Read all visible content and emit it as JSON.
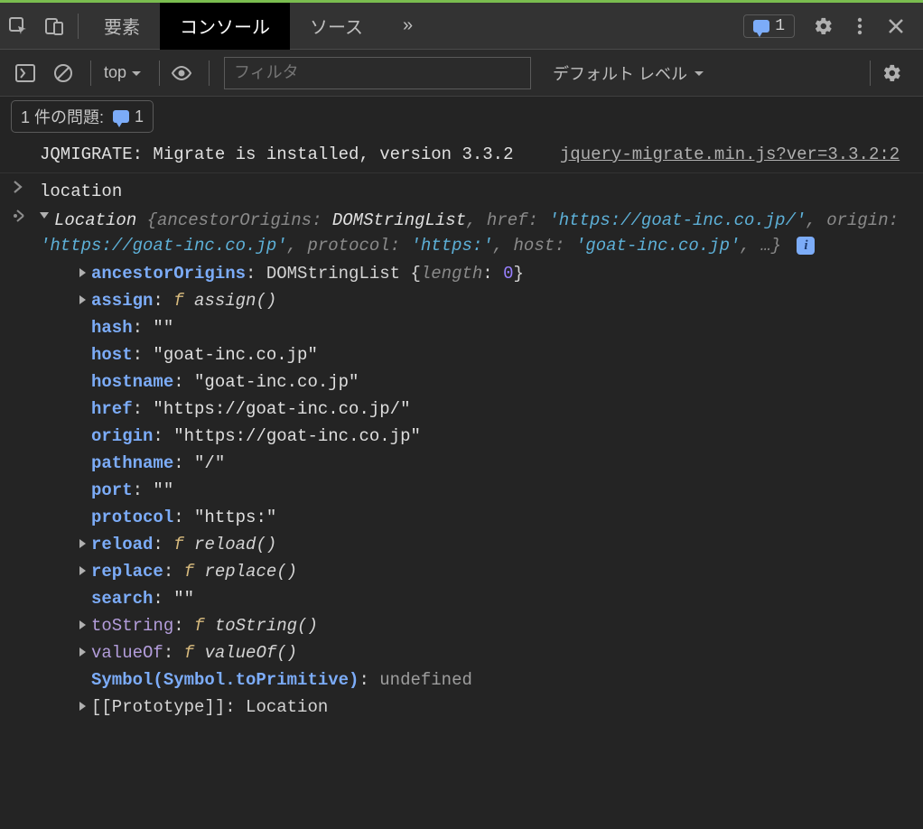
{
  "toolbar": {
    "issues_count": "1"
  },
  "tabs": {
    "elements": "要素",
    "console": "コンソール",
    "sources": "ソース",
    "overflow": "»"
  },
  "toolbar2": {
    "context_label": "top",
    "filter_placeholder": "フィルタ",
    "level_label": "デフォルト レベル"
  },
  "issues_bar": {
    "label": "1 件の問題:",
    "count": "1"
  },
  "logs": {
    "jqmigrate": {
      "message": "JQMIGRATE: Migrate is installed, version 3.3.2",
      "source": "jquery-migrate.min.js?ver=3.3.2:2"
    },
    "input": "location",
    "preview": {
      "type": "Location",
      "parts": {
        "ancestorOrigins": "ancestorOrigins",
        "domstringlist": "DOMStringList",
        "href_k": "href",
        "href_v": "'https://goat-inc.co.jp/'",
        "origin_k": "origin",
        "origin_v": "'https://goat-inc.co.jp'",
        "protocol_k": "protocol",
        "protocol_v": "'https:'",
        "host_k": "host",
        "host_v": "'goat-inc.co.jp'",
        "ellipsis": "…"
      }
    },
    "props": [
      {
        "key": "ancestorOrigins",
        "sep": ": ",
        "val": "DOMStringList {",
        "inner_k": "length",
        "inner_sep": ": ",
        "inner_v": "0",
        "close": "}",
        "expand": true
      },
      {
        "key": "assign",
        "sep": ": ",
        "fn": "assign()",
        "expand": true
      },
      {
        "key": "hash",
        "sep": ": ",
        "str": "\"\""
      },
      {
        "key": "host",
        "sep": ": ",
        "str": "\"goat-inc.co.jp\""
      },
      {
        "key": "hostname",
        "sep": ": ",
        "str": "\"goat-inc.co.jp\""
      },
      {
        "key": "href",
        "sep": ": ",
        "str": "\"https://goat-inc.co.jp/\""
      },
      {
        "key": "origin",
        "sep": ": ",
        "str": "\"https://goat-inc.co.jp\""
      },
      {
        "key": "pathname",
        "sep": ": ",
        "str": "\"/\""
      },
      {
        "key": "port",
        "sep": ": ",
        "str": "\"\""
      },
      {
        "key": "protocol",
        "sep": ": ",
        "str": "\"https:\""
      },
      {
        "key": "reload",
        "sep": ": ",
        "fn": "reload()",
        "expand": true
      },
      {
        "key": "replace",
        "sep": ": ",
        "fn": "replace()",
        "expand": true
      },
      {
        "key": "search",
        "sep": ": ",
        "str": "\"\""
      },
      {
        "key": "toString",
        "sep": ": ",
        "fn": "toString()",
        "expand": true,
        "dim": true
      },
      {
        "key": "valueOf",
        "sep": ": ",
        "fn": "valueOf()",
        "expand": true,
        "dim": true
      },
      {
        "key": "Symbol(Symbol.toPrimitive)",
        "sep": ": ",
        "undef": "undefined",
        "symbol": true
      },
      {
        "key": "[[Prototype]]",
        "sep": ": ",
        "type": "Location",
        "expand": true,
        "internal": true
      }
    ]
  }
}
